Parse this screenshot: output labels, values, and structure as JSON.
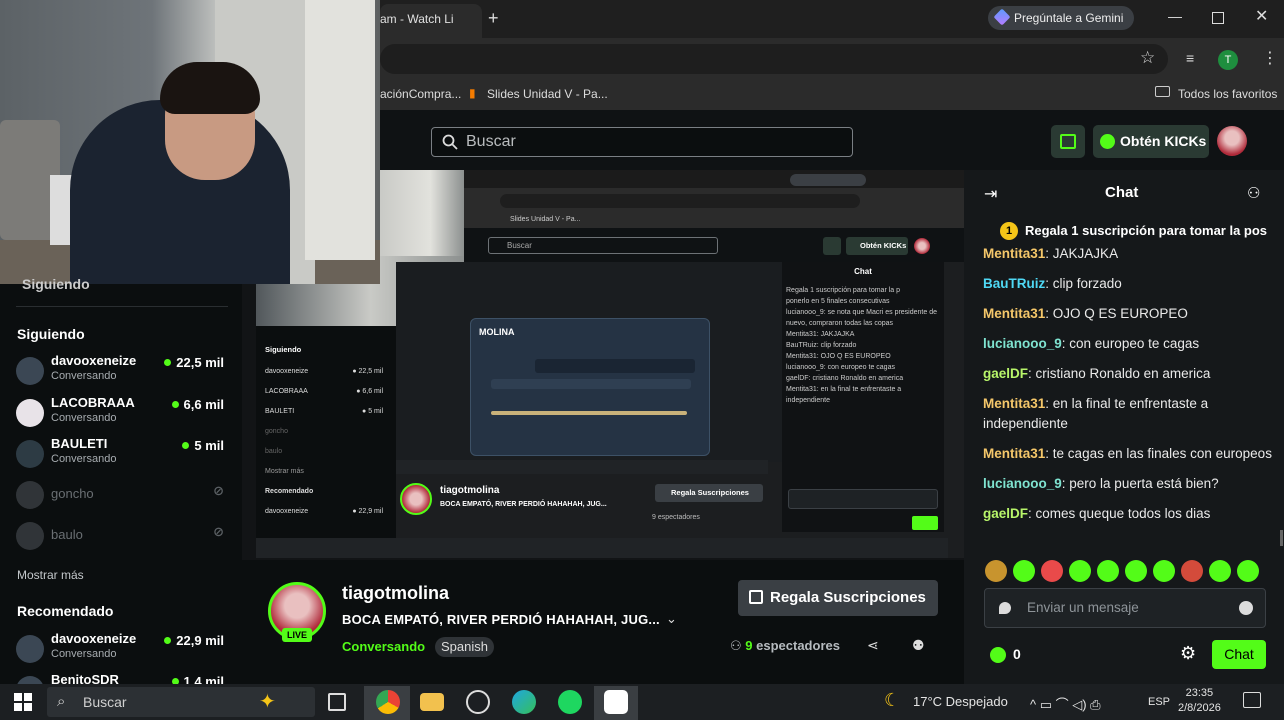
{
  "browser": {
    "tab_title": "am - Watch Li",
    "gemini_label": "Pregúntale a Gemini",
    "profile_initial": "T",
    "bookmarks": [
      "aciónCompra...",
      "Slides Unidad V - Pa..."
    ],
    "all_bookmarks": "Todos los favoritos"
  },
  "header": {
    "search_placeholder": "Buscar",
    "kicks_label": "Obtén KICKs"
  },
  "sidebar": {
    "section_title": "Siguiendo",
    "cut_title": "Siguiendo",
    "following": [
      {
        "name": "davooxeneize",
        "sub": "Conversando",
        "viewers": "22,5 mil",
        "live": true
      },
      {
        "name": "LACOBRAAA",
        "sub": "Conversando",
        "viewers": "6,6 mil",
        "live": true
      },
      {
        "name": "BAULETI",
        "sub": "Conversando",
        "viewers": "5 mil",
        "live": true
      },
      {
        "name": "goncho",
        "sub": "",
        "viewers": "",
        "live": false
      },
      {
        "name": "baulo",
        "sub": "",
        "viewers": "",
        "live": false
      }
    ],
    "show_more": "Mostrar más",
    "recommended_title": "Recomendado",
    "recommended": [
      {
        "name": "davooxeneize",
        "sub": "Conversando",
        "viewers": "22,9 mil"
      },
      {
        "name": "BenitoSDR",
        "sub": "",
        "viewers": "1,4 mil"
      }
    ]
  },
  "stream": {
    "channel": "tiagotmolina",
    "title": "BOCA EMPATÓ, RIVER PERDIÓ HAHAHAH, JUG...",
    "category": "Conversando",
    "language": "Spanish",
    "live_badge": "LIVE",
    "gift_label": "Regala Suscripciones",
    "viewer_count": "9",
    "viewer_label": "espectadores"
  },
  "chat": {
    "title": "Chat",
    "pinned": "Regala 1 suscripción para tomar la pos",
    "messages": [
      {
        "user": "Mentita31",
        "color": "#f5c76a",
        "text": "JAKJAJKA"
      },
      {
        "user": "BauTRuiz",
        "color": "#4fd9f5",
        "text": "clip forzado"
      },
      {
        "user": "Mentita31",
        "color": "#f5c76a",
        "text": "OJO Q ES EUROPEO"
      },
      {
        "user": "lucianooo_9",
        "color": "#7fe3d0",
        "text": "con europeo te cagas"
      },
      {
        "user": "gaelDF",
        "color": "#b8f56a",
        "text": "cristiano Ronaldo en america"
      },
      {
        "user": "Mentita31",
        "color": "#f5c76a",
        "text": "en la final te enfrentaste a independiente"
      },
      {
        "user": "Mentita31",
        "color": "#f5c76a",
        "text": "te cagas en las finales con europeos"
      },
      {
        "user": "lucianooo_9",
        "color": "#7fe3d0",
        "text": "pero la puerta está bien?"
      },
      {
        "user": "gaelDF",
        "color": "#b8f56a",
        "text": "comes queque todos los dias"
      }
    ],
    "input_placeholder": "Enviar un mensaje",
    "kicks_count": "0",
    "send_label": "Chat"
  },
  "inner": {
    "chat_title": "Chat",
    "search": "Buscar",
    "kicks": "Obtén KICKs",
    "channel": "tiagotmolina",
    "title": "BOCA EMPATÓ, RIVER PERDIÓ HAHAHAH, JUG...",
    "gift": "Regala Suscripciones",
    "viewers": "9 espectadores",
    "following": "Siguiendo",
    "msgs": [
      "Regala 1 suscripción para tomar la p",
      "ponerlo en 5 finales consecutivas",
      "lucianooo_9: se nota que Macri es presidente de nuevo, compraron todas las copas",
      "Mentita31: JAKJAJKA",
      "BauTRuiz: clip forzado",
      "Mentita31: OJO Q ES EUROPEO",
      "lucianooo_9: con europeo te cagas",
      "gaelDF: cristiano Ronaldo en america",
      "Mentita31: en la final te enfrentaste a independiente"
    ]
  },
  "taskbar": {
    "search": "Buscar",
    "weather": "17°C  Despejado",
    "lang": "ESP",
    "time": "23:35",
    "date": "2/8/2026"
  },
  "colors": {
    "accent": "#53fc18",
    "bg": "#0b0e0f"
  }
}
